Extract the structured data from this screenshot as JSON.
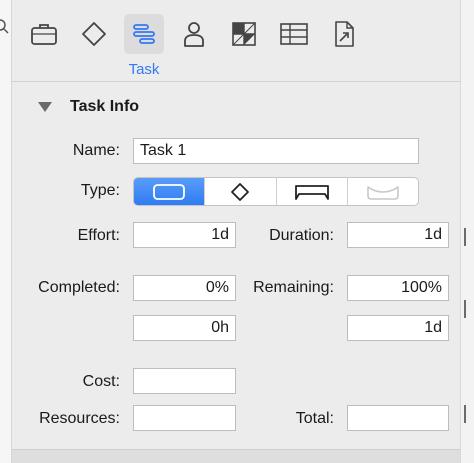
{
  "toolbar": {
    "active_tab_label": "Task",
    "tools": [
      {
        "icon": "briefcase-icon"
      },
      {
        "icon": "milestone-diamond-icon"
      },
      {
        "icon": "task-bars-icon",
        "active": true
      },
      {
        "icon": "person-icon"
      },
      {
        "icon": "grid-pattern-icon"
      },
      {
        "icon": "table-icon"
      },
      {
        "icon": "export-document-icon"
      }
    ],
    "accent_color": "#3478f6"
  },
  "task_info": {
    "section_title": "Task Info",
    "name_label": "Name:",
    "name_value": "Task 1",
    "type_label": "Type:",
    "type_options": [
      "task-shape-icon",
      "milestone-shape-icon",
      "group-shape-icon",
      "hammock-shape-icon"
    ],
    "type_selected": 0,
    "effort_label": "Effort:",
    "effort_value": "1d",
    "duration_label": "Duration:",
    "duration_value": "1d",
    "completed_label": "Completed:",
    "completed_value": "0%",
    "remaining_label": "Remaining:",
    "remaining_value": "100%",
    "completed_hours_value": "0h",
    "remaining_days_value": "1d",
    "cost_label": "Cost:",
    "cost_value": "",
    "resources_label": "Resources:",
    "resources_value": "",
    "total_label": "Total:",
    "total_value": ""
  }
}
